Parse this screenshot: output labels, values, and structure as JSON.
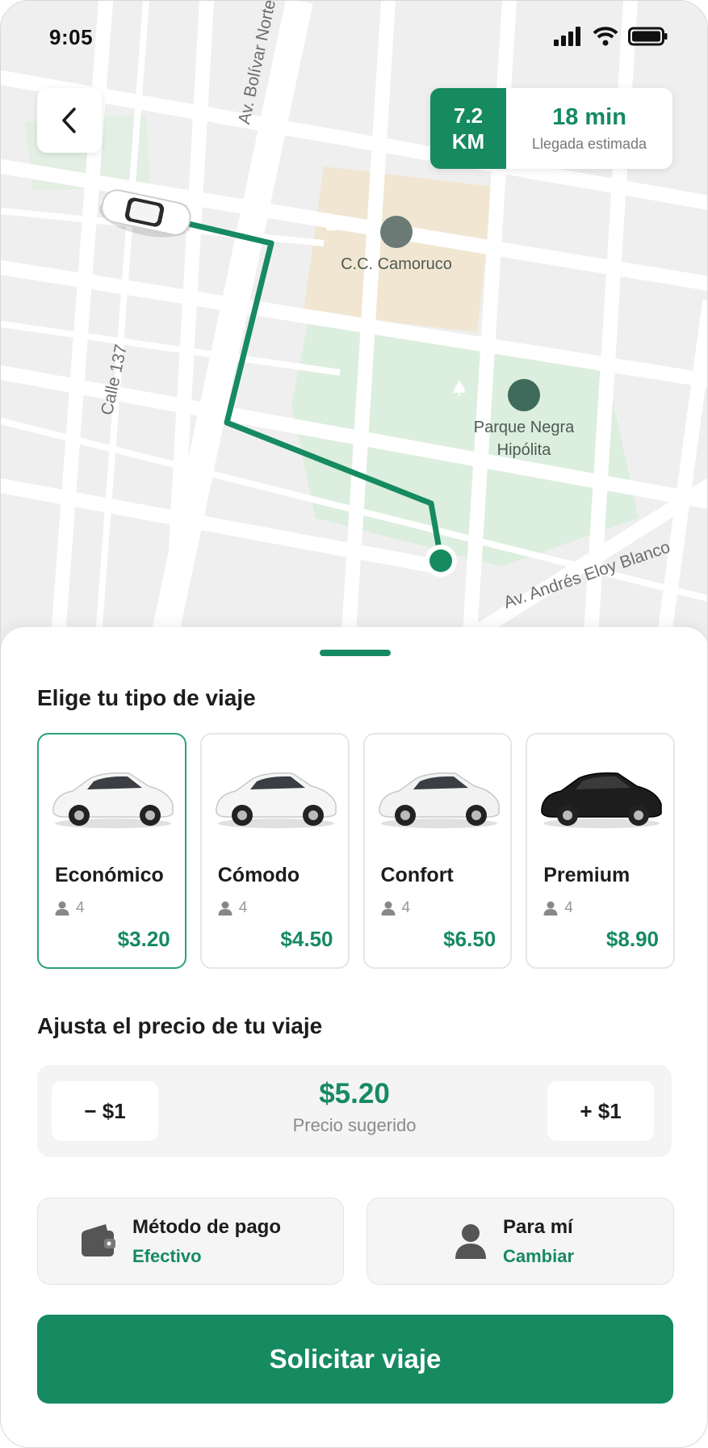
{
  "status_bar": {
    "time": "9:05"
  },
  "map": {
    "streets": {
      "bolivar": "Av. Bolívar Norte",
      "calle": "Calle 137",
      "andres": "Av. Andrés Eloy Blanco"
    },
    "pois": {
      "mall": "C.C. Camoruco",
      "park_line1": "Parque Negra",
      "park_line2": "Hipólita"
    },
    "icons": {
      "back": "chevron-left-icon",
      "mall": "shopping-bag-icon",
      "park": "tree-icon"
    }
  },
  "eta": {
    "distance_value": "7.2",
    "distance_unit": "KM",
    "time": "18 min",
    "time_label": "Llegada estimada"
  },
  "sheet": {
    "types_title": "Elige tu tipo de viaje",
    "types": [
      {
        "name": "Económico",
        "seats": "4",
        "price": "$3.20",
        "selected": true,
        "car_color": "#f5f5f5"
      },
      {
        "name": "Cómodo",
        "seats": "4",
        "price": "$4.50",
        "selected": false,
        "car_color": "#f5f5f5"
      },
      {
        "name": "Confort",
        "seats": "4",
        "price": "$6.50",
        "selected": false,
        "car_color": "#f2f2f2"
      },
      {
        "name": "Premium",
        "seats": "4",
        "price": "$8.90",
        "selected": false,
        "car_color": "#1d1d1d"
      }
    ],
    "price_title": "Ajusta el precio de tu viaje",
    "price": {
      "minus_label": "− $1",
      "plus_label": "+ $1",
      "value": "$5.20",
      "caption": "Precio sugerido"
    },
    "payment": {
      "title": "Método de pago",
      "value": "Efectivo",
      "icon": "wallet-icon"
    },
    "rider": {
      "title": "Para mí",
      "value": "Cambiar",
      "icon": "person-icon"
    },
    "cta_label": "Solicitar viaje"
  },
  "colors": {
    "brand_green": "#168a60",
    "park_green": "#dbeedd",
    "mall_tan": "#f3e8d4"
  }
}
